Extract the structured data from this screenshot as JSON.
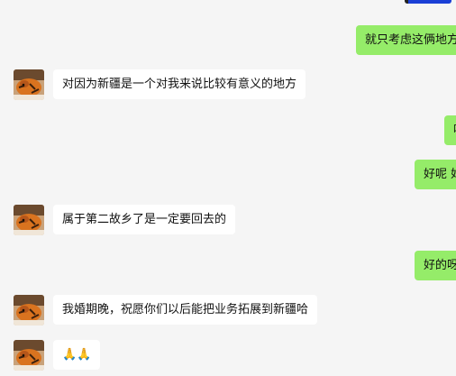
{
  "messages": [
    {
      "side": "out",
      "text": "就只考虑这俩地方"
    },
    {
      "side": "in",
      "text": "对因为新疆是一个对我来说比较有意义的地方"
    },
    {
      "side": "out",
      "text": "哈"
    },
    {
      "side": "out",
      "text": "好呢 好"
    },
    {
      "side": "in",
      "text": "属于第二故乡了是一定要回去的"
    },
    {
      "side": "out",
      "text": "好的呀"
    },
    {
      "side": "in",
      "text": "我婚期晚，祝愿你们以后能把业务拓展到新疆哈"
    },
    {
      "side": "in",
      "text": "🙏🙏"
    }
  ],
  "colors": {
    "background": "#f5f5f5",
    "incoming_bubble": "#ffffff",
    "outgoing_bubble": "#95ec69"
  },
  "icons": {
    "contact_avatar": "tiger-photo-avatar",
    "self_avatar": "blue-avatar"
  }
}
